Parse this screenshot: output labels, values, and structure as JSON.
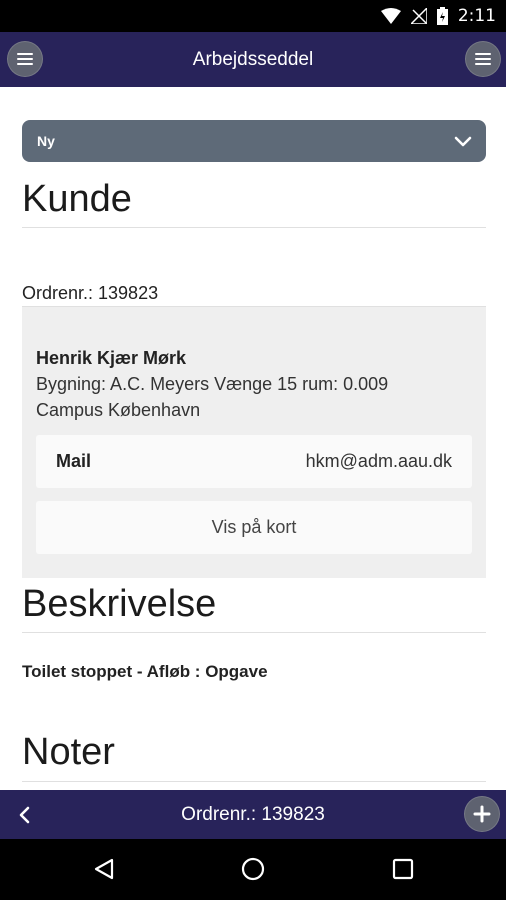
{
  "status_bar": {
    "time": "2:11"
  },
  "header": {
    "title": "Arbejdsseddel"
  },
  "status_select": {
    "value": "Ny"
  },
  "kunde": {
    "title": "Kunde",
    "order_label": "Ordrenr.: 139823",
    "name": "Henrik Kjær Mørk",
    "building": "Bygning: A.C. Meyers Vænge 15 rum: 0.009",
    "campus": "Campus København",
    "mail_label": "Mail",
    "mail_value": "hkm@adm.aau.dk",
    "map_button": "Vis på kort"
  },
  "beskrivelse": {
    "title": "Beskrivelse",
    "text": "Toilet stoppet - Afløb : Opgave"
  },
  "noter": {
    "title": "Noter"
  },
  "bottom_bar": {
    "title": "Ordrenr.: 139823"
  },
  "colors": {
    "header": "#28235a",
    "select": "#5e6a78",
    "card": "#efefef"
  }
}
